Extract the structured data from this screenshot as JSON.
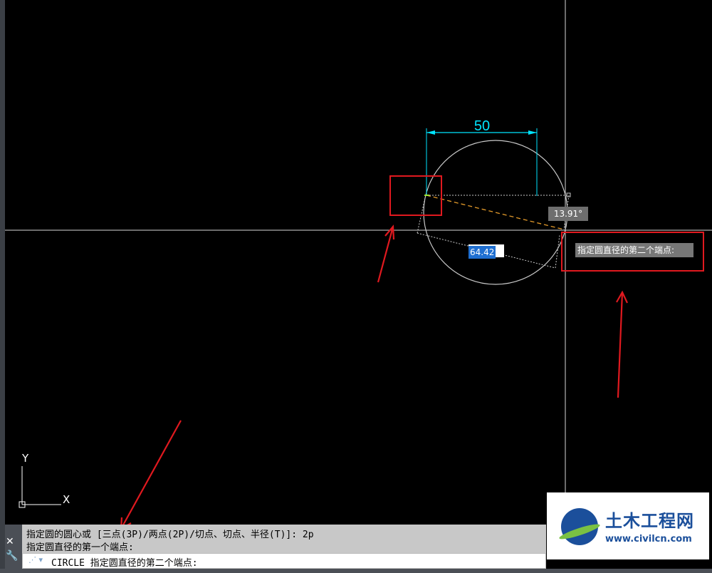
{
  "drawing": {
    "dimension_text": "50",
    "angle_tooltip": "13.91°",
    "length_input": "64.42",
    "prompt_tooltip": "指定圆直径的第二个端点:",
    "ucs": {
      "x_label": "X",
      "y_label": "Y"
    }
  },
  "command_line": {
    "history_line1": "指定圆的圆心或 [三点(3P)/两点(2P)/切点、切点、半径(T)]: 2p",
    "history_line2": "指定圆直径的第一个端点:",
    "current_command": "CIRCLE 指定圆直径的第二个端点:",
    "close_icon": "close-icon",
    "settings_icon": "wrench-icon",
    "dropdown_icon": "command-dropdown-icon"
  },
  "watermark": {
    "name": "土木工程网",
    "url": "www.civilcn.com"
  },
  "colors": {
    "background": "#000000",
    "dimension": "#00e5ff",
    "annotation": "#e0191f",
    "rubber_band": "#e39a2a"
  }
}
